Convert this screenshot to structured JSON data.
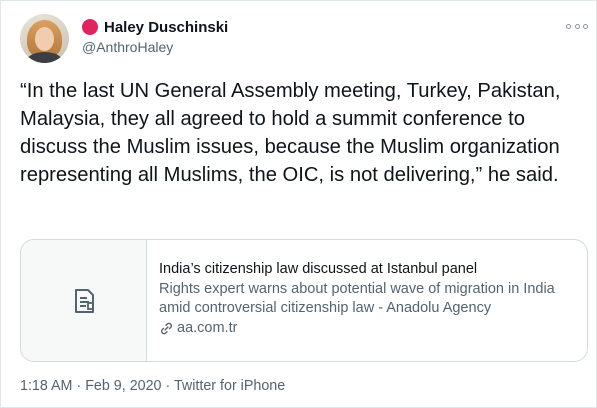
{
  "user": {
    "display_name": "Haley Duschinski",
    "handle": "@AnthroHaley",
    "badge_color": "#e0245e",
    "avatar_icon": "avatar-photo"
  },
  "tweet": {
    "text": "“In the last UN General Assembly meeting, Turkey, Pakistan, Malaysia, they all agreed to hold a summit conference to discuss the Muslim issues, because the Muslim organization representing all Muslims, the OIC, is not delivering,” he said."
  },
  "card": {
    "icon": "document-icon",
    "title": "India’s citizenship law discussed at Istanbul panel",
    "description": "Rights expert warns about potential wave of migration in India amid controversial citizenship law - Anadolu Agency",
    "domain": "aa.com.tr",
    "domain_icon": "link-icon"
  },
  "meta": {
    "time": "1:18 AM",
    "separator": " · ",
    "date": "Feb 9, 2020",
    "source": "Twitter for iPhone"
  },
  "colors": {
    "text": "#0f1419",
    "secondary": "#536471",
    "border": "#cfd9de"
  }
}
